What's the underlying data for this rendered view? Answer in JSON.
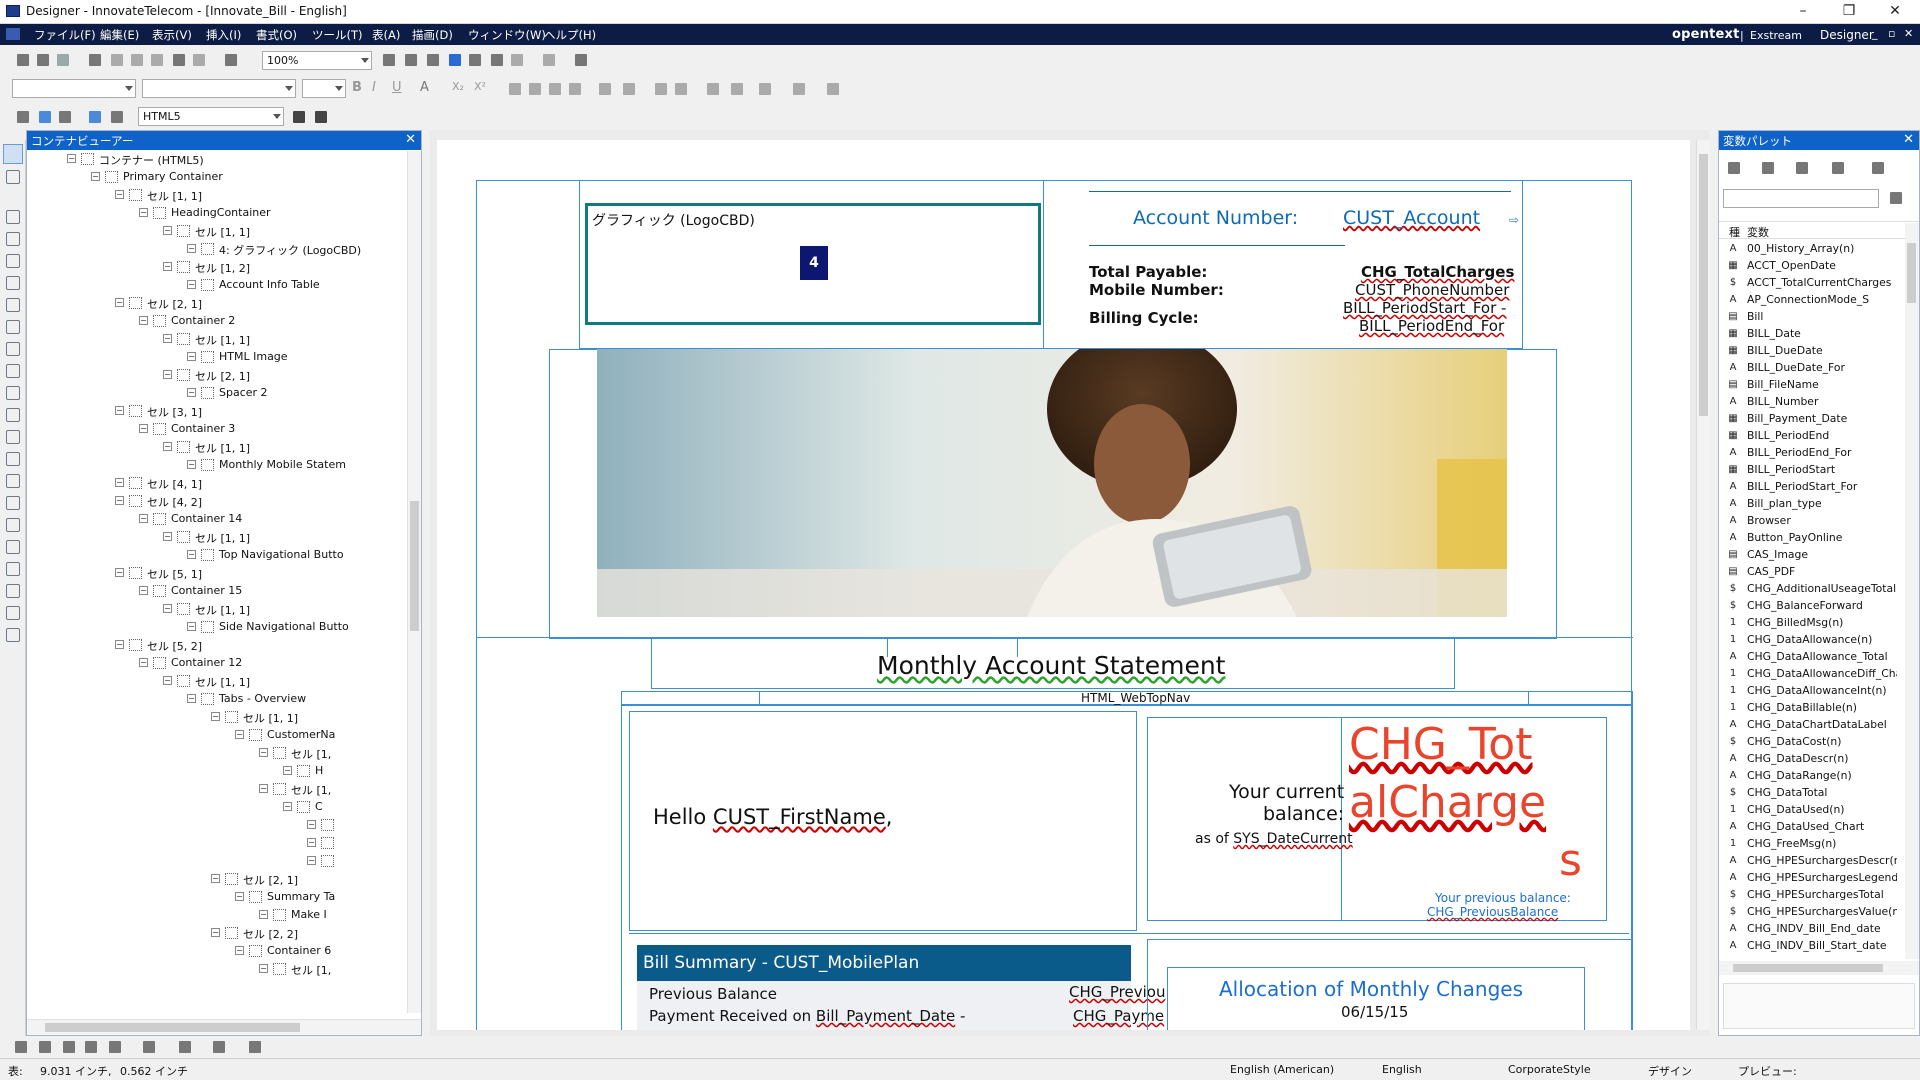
{
  "window": {
    "title": "Designer - InnovateTelecom - [Innovate_Bill - English]",
    "min_icon": "minimize-icon",
    "max_icon": "maximize-icon",
    "close_icon": "close-icon"
  },
  "menu": {
    "items": [
      "ファイル(F)",
      "編集(E)",
      "表示(V)",
      "挿入(I)",
      "書式(O)",
      "ツール(T)",
      "表(A)",
      "描画(D)",
      "ウィンドウ(W)",
      "ヘルプ(H)"
    ],
    "brand_open": "opentext",
    "brand_sep": "|",
    "brand_exstream": "Exstream",
    "brand_designer": "Designer"
  },
  "toolbar": {
    "zoom": "100%",
    "output_mode": "HTML5"
  },
  "content_viewer": {
    "title": "コンテナビューアー",
    "tree": [
      {
        "label": "コンテナー (HTML5)",
        "level": 0
      },
      {
        "label": "Primary Container",
        "level": 1
      },
      {
        "label": "セル [1, 1]",
        "level": 2
      },
      {
        "label": "HeadingContainer",
        "level": 3
      },
      {
        "label": "セル [1, 1]",
        "level": 4
      },
      {
        "label": "4: グラフィック (LogoCBD)",
        "level": 5
      },
      {
        "label": "セル [1, 2]",
        "level": 4
      },
      {
        "label": "Account Info Table",
        "level": 5
      },
      {
        "label": "セル [2, 1]",
        "level": 2
      },
      {
        "label": "Container 2",
        "level": 3
      },
      {
        "label": "セル [1, 1]",
        "level": 4
      },
      {
        "label": "HTML Image",
        "level": 5
      },
      {
        "label": "セル [2, 1]",
        "level": 4
      },
      {
        "label": "Spacer 2",
        "level": 5
      },
      {
        "label": "セル [3, 1]",
        "level": 2
      },
      {
        "label": "Container 3",
        "level": 3
      },
      {
        "label": "セル [1, 1]",
        "level": 4
      },
      {
        "label": "Monthly Mobile Statem",
        "level": 5
      },
      {
        "label": "セル [4, 1]",
        "level": 2
      },
      {
        "label": "セル [4, 2]",
        "level": 2
      },
      {
        "label": "Container 14",
        "level": 3
      },
      {
        "label": "セル [1, 1]",
        "level": 4
      },
      {
        "label": "Top Navigational Butto",
        "level": 5
      },
      {
        "label": "セル [5, 1]",
        "level": 2
      },
      {
        "label": "Container 15",
        "level": 3
      },
      {
        "label": "セル [1, 1]",
        "level": 4
      },
      {
        "label": "Side Navigational Butto",
        "level": 5
      },
      {
        "label": "セル [5, 2]",
        "level": 2
      },
      {
        "label": "Container 12",
        "level": 3
      },
      {
        "label": "セル [1, 1]",
        "level": 4
      },
      {
        "label": "Tabs - Overview",
        "level": 5
      },
      {
        "label": "セル [1, 1]",
        "level": 6
      },
      {
        "label": "CustomerNa",
        "level": 7
      },
      {
        "label": "セル [1,",
        "level": 8
      },
      {
        "label": "H",
        "level": 9
      },
      {
        "label": "セル [1,",
        "level": 8
      },
      {
        "label": "C",
        "level": 9
      },
      {
        "label": "",
        "level": 10
      },
      {
        "label": "",
        "level": 10
      },
      {
        "label": "",
        "level": 10
      },
      {
        "label": "セル [2, 1]",
        "level": 6
      },
      {
        "label": "Summary Ta",
        "level": 7
      },
      {
        "label": "Make I",
        "level": 8
      },
      {
        "label": "セル [2, 2]",
        "level": 6
      },
      {
        "label": "Container 6",
        "level": 7
      },
      {
        "label": "セル [1,",
        "level": 8
      }
    ]
  },
  "canvas": {
    "logo_label": "グラフィック (LogoCBD)",
    "logo_badge": "4",
    "account_number_label": "Account Number:",
    "account_number_var": "CUST_Account",
    "total_payable_label": "Total Payable:",
    "total_payable_var": "CHG_TotalCharges",
    "mobile_label": "Mobile Number:",
    "mobile_var": "CUST_PhoneNumber",
    "billing_label": "Billing Cycle:",
    "billing_var1": "BILL_PeriodStart_For -",
    "billing_var2": "BILL_PeriodEnd_For",
    "statement_title": "Monthly Account Statement",
    "web_top_nav": "HTML_WebTopNav",
    "hello_prefix": "Hello ",
    "hello_var": "CUST_FirstName",
    "hello_suffix": ",",
    "balance_label1": "Your current",
    "balance_label2": "balance:",
    "as_of_prefix": "as of ",
    "as_of_var": "SYS_DateCurrent",
    "big_charge_1": "CHG_Tot",
    "big_charge_2": "alCharge",
    "big_charge_3": "s",
    "prev_balance_label": "Your previous balance:",
    "prev_balance_var": "CHG_PreviousBalance",
    "bill_summary_title": "Bill Summary - CUST_MobilePlan",
    "previous_balance": "Previous Balance",
    "previous_balance_var": "CHG_Previou",
    "payment_received": "Payment Received on ",
    "payment_date_var": "Bill_Payment_Date",
    "payment_dash": " -",
    "payment_var": "CHG_Payme",
    "allocation_title": "Allocation of Monthly Changes",
    "allocation_date": "06/15/15"
  },
  "variable_palette": {
    "title": "変数パレット",
    "col_type": "種",
    "col_name": "変数",
    "items": [
      {
        "icon": "A",
        "name": "00_History_Array(n)"
      },
      {
        "icon": "▦",
        "name": "ACCT_OpenDate"
      },
      {
        "icon": "$",
        "name": "ACCT_TotalCurrentCharges"
      },
      {
        "icon": "A",
        "name": "AP_ConnectionMode_S"
      },
      {
        "icon": "▤",
        "name": "Bill"
      },
      {
        "icon": "▦",
        "name": "BILL_Date"
      },
      {
        "icon": "▦",
        "name": "BILL_DueDate"
      },
      {
        "icon": "A",
        "name": "BILL_DueDate_For"
      },
      {
        "icon": "▤",
        "name": "Bill_FileName"
      },
      {
        "icon": "A",
        "name": "BILL_Number"
      },
      {
        "icon": "▦",
        "name": "Bill_Payment_Date"
      },
      {
        "icon": "▦",
        "name": "BILL_PeriodEnd"
      },
      {
        "icon": "A",
        "name": "BILL_PeriodEnd_For"
      },
      {
        "icon": "▦",
        "name": "BILL_PeriodStart"
      },
      {
        "icon": "A",
        "name": "BILL_PeriodStart_For"
      },
      {
        "icon": "A",
        "name": "Bill_plan_type"
      },
      {
        "icon": "A",
        "name": "Browser"
      },
      {
        "icon": "A",
        "name": "Button_PayOnline"
      },
      {
        "icon": "▤",
        "name": "CAS_Image"
      },
      {
        "icon": "▤",
        "name": "CAS_PDF"
      },
      {
        "icon": "$",
        "name": "CHG_AdditionalUseageTotal"
      },
      {
        "icon": "$",
        "name": "CHG_BalanceForward"
      },
      {
        "icon": "1",
        "name": "CHG_BilledMsg(n)"
      },
      {
        "icon": "1",
        "name": "CHG_DataAllowance(n)"
      },
      {
        "icon": "A",
        "name": "CHG_DataAllowance_Total"
      },
      {
        "icon": "1",
        "name": "CHG_DataAllowanceDiff_Cha"
      },
      {
        "icon": "1",
        "name": "CHG_DataAllowanceInt(n)"
      },
      {
        "icon": "1",
        "name": "CHG_DataBillable(n)"
      },
      {
        "icon": "A",
        "name": "CHG_DataChartDataLabel"
      },
      {
        "icon": "$",
        "name": "CHG_DataCost(n)"
      },
      {
        "icon": "A",
        "name": "CHG_DataDescr(n)"
      },
      {
        "icon": "A",
        "name": "CHG_DataRange(n)"
      },
      {
        "icon": "$",
        "name": "CHG_DataTotal"
      },
      {
        "icon": "1",
        "name": "CHG_DataUsed(n)"
      },
      {
        "icon": "A",
        "name": "CHG_DataUsed_Chart"
      },
      {
        "icon": "1",
        "name": "CHG_FreeMsg(n)"
      },
      {
        "icon": "A",
        "name": "CHG_HPESurchargesDescr(n"
      },
      {
        "icon": "A",
        "name": "CHG_HPESurchargesLegend"
      },
      {
        "icon": "$",
        "name": "CHG_HPESurchargesTotal"
      },
      {
        "icon": "$",
        "name": "CHG_HPESurchargesValue(n"
      },
      {
        "icon": "A",
        "name": "CHG_INDV_Bill_End_date"
      },
      {
        "icon": "A",
        "name": "CHG_INDV_Bill_Start_date"
      }
    ]
  },
  "status": {
    "position_label": "表:",
    "x": "9.031 インチ,",
    "y": "0.562 インチ",
    "lang1": "English (American)",
    "lang2": "English",
    "style": "CorporateStyle",
    "mode1": "デザイン",
    "mode2": "プレビュー:"
  },
  "colors": {
    "menubar": "#0d1c44",
    "panel_header": "#0f62c8",
    "accent_blue": "#0f6ab4",
    "charge_red": "#e8452c",
    "teal_frame": "#0f7b7e",
    "bill_summary_bar": "#0b5b8a"
  }
}
